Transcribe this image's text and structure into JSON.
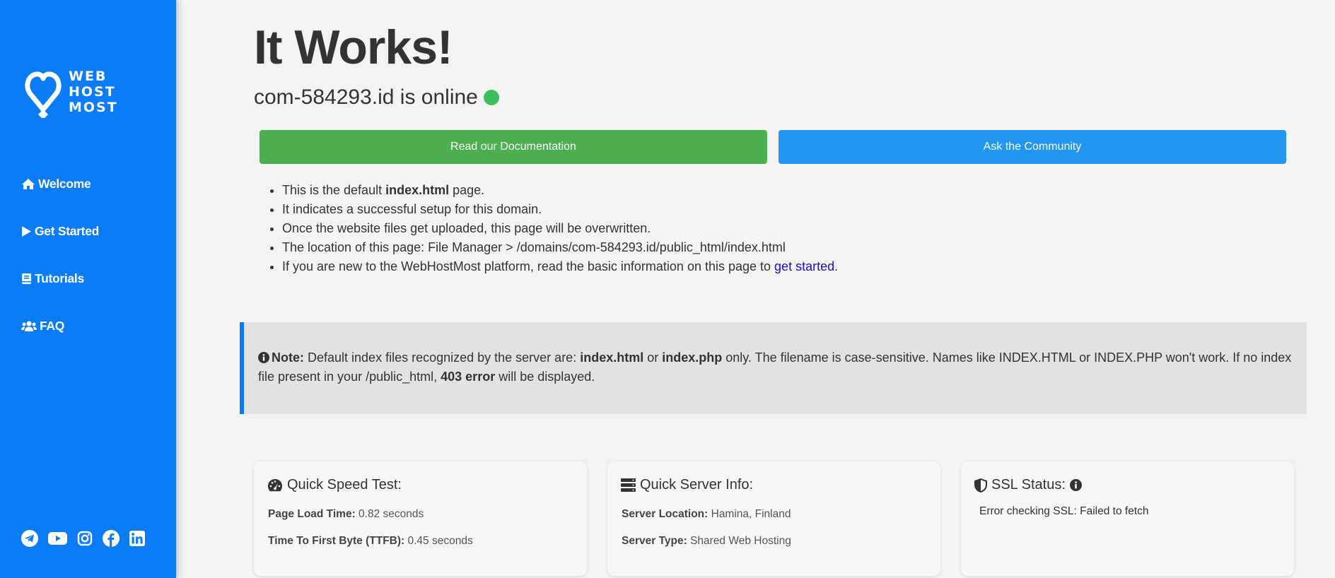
{
  "brand": {
    "logo_text_line1": "WEB",
    "logo_text_line2": "HOST",
    "logo_text_line3": "MOST",
    "sidebar_color": "#0a7cf7"
  },
  "nav": {
    "items": [
      {
        "label": "Welcome",
        "icon": "home-icon"
      },
      {
        "label": "Get Started",
        "icon": "play-icon"
      },
      {
        "label": "Tutorials",
        "icon": "book-icon"
      },
      {
        "label": "FAQ",
        "icon": "users-icon"
      }
    ]
  },
  "socials": [
    "telegram-icon",
    "youtube-icon",
    "instagram-icon",
    "facebook-icon",
    "linkedin-icon"
  ],
  "page": {
    "title": "It Works!",
    "domain_status": "com-584293.id is online",
    "status_color": "#3cbf5c"
  },
  "buttons": {
    "docs_label": "Read our Documentation",
    "community_label": "Ask the Community",
    "docs_color": "#4caf50",
    "community_color": "#2196f3"
  },
  "info": {
    "item1_pre": "This is the default ",
    "item1_bold": "index.html",
    "item1_post": " page.",
    "item2": "It indicates a successful setup for this domain.",
    "item3": "Once the website files get uploaded, this page will be overwritten.",
    "item4": "The location of this page: File Manager > /domains/com-584293.id/public_html/index.html",
    "item5_pre": "If you are new to the WebHostMost platform, read the basic information on this page to ",
    "item5_link": "get started",
    "item5_post": "."
  },
  "note": {
    "label": "Note:",
    "text1": " Default index files recognized by the server are: ",
    "bold1": "index.html",
    "text2": " or ",
    "bold2": "index.php",
    "text3": " only. The filename is case-sensitive. Names like INDEX.HTML or INDEX.PHP won't work. If no index file present in your /public_html, ",
    "bold3": "403 error",
    "text4": " will be displayed."
  },
  "cards": {
    "speed": {
      "title": "Quick Speed Test:",
      "row1_label": "Page Load Time:",
      "row1_value": " 0.82 seconds",
      "row2_label": "Time To First Byte (TTFB):",
      "row2_value": " 0.45 seconds"
    },
    "server": {
      "title": "Quick Server Info:",
      "row1_label": "Server Location:",
      "row1_value": " Hamina, Finland",
      "row2_label": "Server Type:",
      "row2_value": " Shared Web Hosting"
    },
    "ssl": {
      "title": "SSL Status:",
      "message": "Error checking SSL: Failed to fetch"
    }
  }
}
